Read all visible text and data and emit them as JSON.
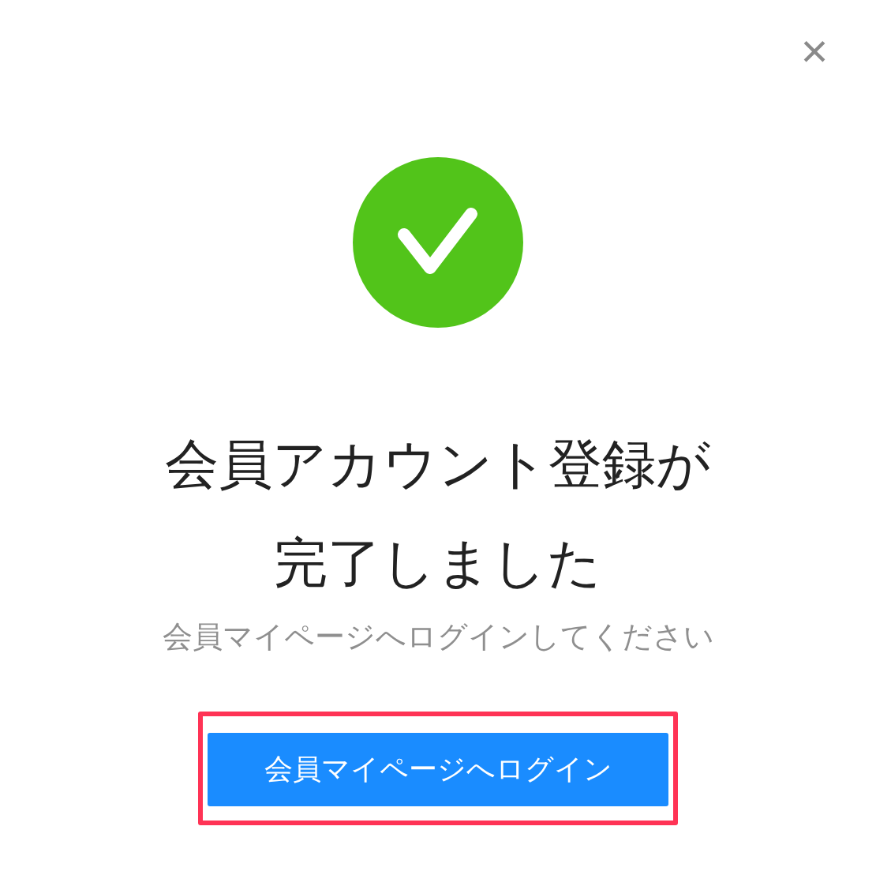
{
  "close_button": {
    "label": "×"
  },
  "status": {
    "kind": "success"
  },
  "title": "会員アカウント登録が完了しました",
  "message": "会員マイページへログインしてください",
  "login_button": {
    "label": "会員マイページへログイン",
    "highlighted": true
  }
}
